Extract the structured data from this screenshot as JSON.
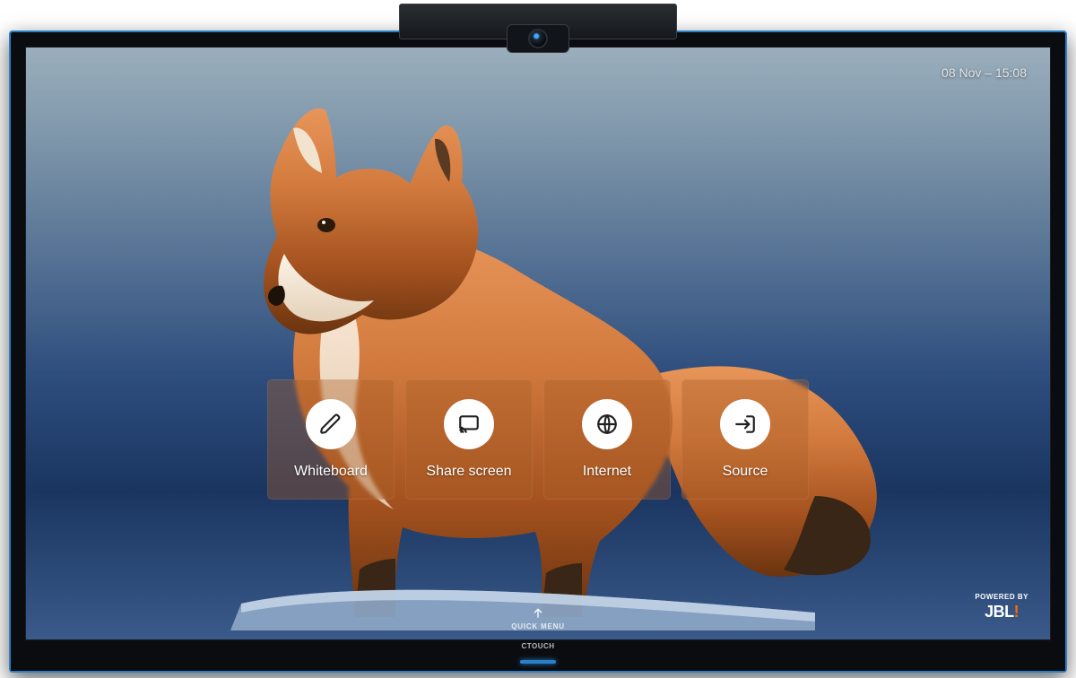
{
  "clock": "08 Nov – 15:08",
  "tiles": [
    {
      "key": "whiteboard",
      "label": "Whiteboard",
      "icon": "pencil-icon"
    },
    {
      "key": "sharescreen",
      "label": "Share screen",
      "icon": "cast-icon"
    },
    {
      "key": "internet",
      "label": "Internet",
      "icon": "globe-icon"
    },
    {
      "key": "source",
      "label": "Source",
      "icon": "input-icon"
    }
  ],
  "quick_menu": {
    "label": "QUICK MENU"
  },
  "powered_by": {
    "prefix": "POWERED BY",
    "brand": "JBL"
  },
  "device_brand": "CTOUCH",
  "colors": {
    "tile_bg": "rgba(170,95,40,.38)",
    "accent_blue": "#2a80c8",
    "text_light": "#ffffff"
  }
}
